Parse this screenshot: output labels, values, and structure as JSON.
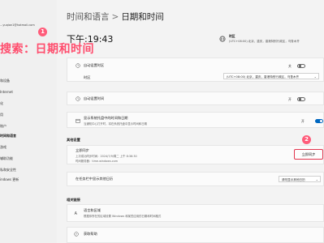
{
  "sidebar": {
    "email": "...yuqian1@hotmail.com",
    "items": [
      {
        "label": "和设备",
        "active": false
      },
      {
        "label": "Internet",
        "active": false
      },
      {
        "label": "化",
        "active": false
      },
      {
        "label": "用",
        "active": false
      },
      {
        "label": "账户",
        "active": false
      },
      {
        "label": "时间和语言",
        "active": true
      },
      {
        "label": "游戏",
        "active": false
      },
      {
        "label": "辅助功能",
        "active": false
      },
      {
        "label": "私和安全性",
        "active": false
      },
      {
        "label": "indows 更新",
        "active": false
      }
    ]
  },
  "overlay": {
    "search_text": "搜索：日期和时间",
    "badge1": "1",
    "badge2": "2"
  },
  "header": {
    "breadcrumb_parent": "时间和语言",
    "breadcrumb_sep": ">",
    "breadcrumb_current": "日期和时间"
  },
  "clock": {
    "time_text": "下午:19:43",
    "timezone_label": "时区",
    "timezone_value": "(UTC+08:00) 北京，重庆，香港特别行政区，乌鲁木齐"
  },
  "settings": {
    "auto_timezone_label": "自动设置时区",
    "auto_timezone_state": "关",
    "timezone_row_label": "时区",
    "timezone_dropdown_value": "(UTC+08:00) 北京，重庆，香港特别行政区，乌鲁木齐",
    "auto_time_label": "自动设置时间",
    "auto_time_state": "开",
    "taskbar_label": "显示系统托盘中的时间和日期",
    "taskbar_sub": "当通知中心打开时，将在系统托盘中显示时间和日期",
    "taskbar_state": "开"
  },
  "extra": {
    "section_title": "其他设置",
    "sync_title": "立即同步",
    "sync_last": "上次成功同步时间：2024/7/9/周二 上午 8:36:30",
    "sync_server": "时间服务器：time.windows.com",
    "sync_button": "立即同步",
    "calendar_label": "在任务栏中显示其他日历",
    "calendar_value": "请勿显示其他日历"
  },
  "related": {
    "section_title": "相关链接",
    "lang_region_title": "语言和区域",
    "lang_region_sub": "根据你所在的区域设置 Windows 和某些应用的日期和时间格式",
    "help_title": "获取帮助"
  },
  "colors": {
    "accent": "#0067c0",
    "annotation": "#ff4d6d"
  }
}
